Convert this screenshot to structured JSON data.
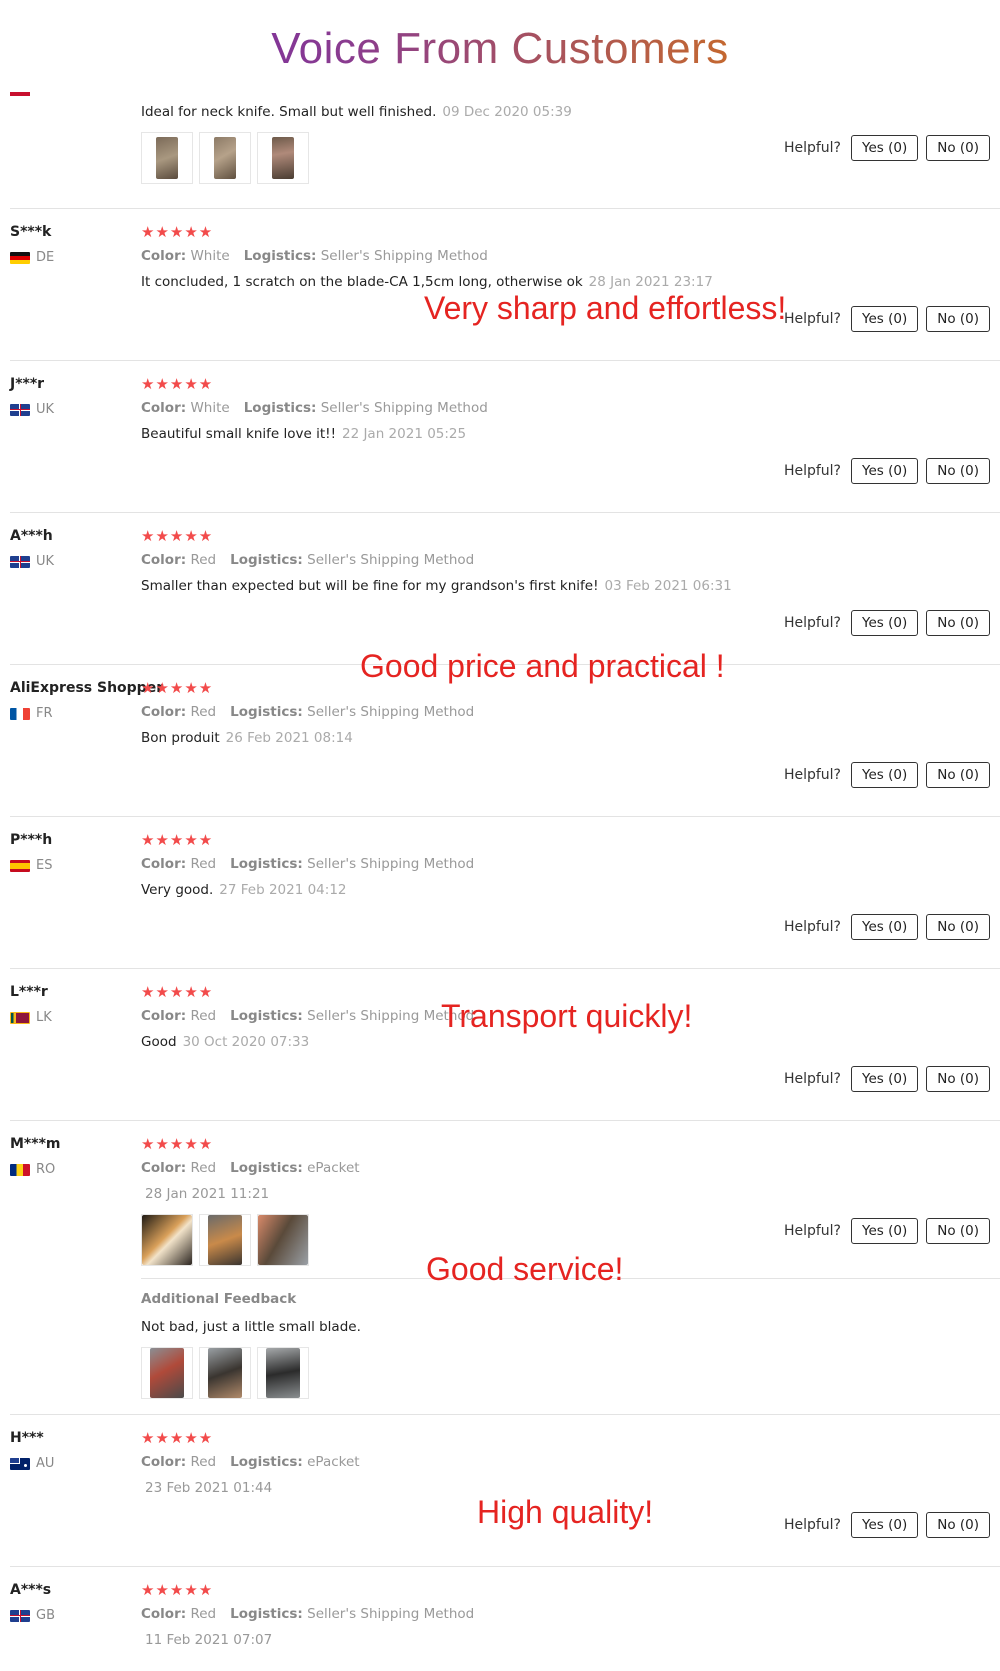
{
  "page_title": "Voice From Customers",
  "helpful_label": "Helpful?",
  "yes_label": "Yes (0)",
  "no_label": "No (0)",
  "color_label": "Color:",
  "logistics_label": "Logistics:",
  "stars": "★★★★★",
  "colors": {
    "star": "#f24b4b",
    "overlay": "#e52421"
  },
  "first_review": {
    "text": "Ideal for neck knife. Small but well finished.",
    "date": "09 Dec 2020 05:39",
    "thumbs": 3
  },
  "reviews": [
    {
      "user": "S***k",
      "country": "DE",
      "flag": "de",
      "color": "White",
      "logistics": "Seller's Shipping Method",
      "text": "It concluded, 1 scratch on the blade-CA 1,5cm long, otherwise ok",
      "date": "28 Jan 2021 23:17"
    },
    {
      "user": "J***r",
      "country": "UK",
      "flag": "uk",
      "color": "White",
      "logistics": "Seller's Shipping Method",
      "text": "Beautiful small knife love it!!",
      "date": "22 Jan 2021 05:25"
    },
    {
      "user": "A***h",
      "country": "UK",
      "flag": "uk",
      "color": "Red",
      "logistics": "Seller's Shipping Method",
      "text": "Smaller than expected but will be fine for my grandson's first knife!",
      "date": "03 Feb 2021 06:31"
    },
    {
      "user": "AliExpress Shopper",
      "country": "FR",
      "flag": "fr",
      "color": "Red",
      "logistics": "Seller's Shipping Method",
      "text": "Bon produit",
      "date": "26 Feb 2021 08:14"
    },
    {
      "user": "P***h",
      "country": "ES",
      "flag": "es",
      "color": "Red",
      "logistics": "Seller's Shipping Method",
      "text": "Very good.",
      "date": "27 Feb 2021 04:12"
    },
    {
      "user": "L***r",
      "country": "LK",
      "flag": "lk",
      "color": "Red",
      "logistics": "Seller's Shipping Method",
      "text": "Good",
      "date": "30 Oct 2020 07:33"
    },
    {
      "user": "M***m",
      "country": "RO",
      "flag": "ro",
      "color": "Red",
      "logistics": "ePacket",
      "date_only": "28 Jan 2021 11:21",
      "additional_label": "Additional Feedback",
      "additional_text": "Not bad, just a little small blade."
    },
    {
      "user": "H***",
      "country": "AU",
      "flag": "au",
      "color": "Red",
      "logistics": "ePacket",
      "date_only": "23 Feb 2021 01:44"
    },
    {
      "user": "A***s",
      "country": "GB",
      "flag": "uk",
      "color": "Red",
      "logistics": "Seller's Shipping Method",
      "date_only": "11 Feb 2021 07:07"
    }
  ],
  "overlays": [
    "Very sharp and effortless!",
    "Good price and practical !",
    "Transport quickly!",
    "Good service!",
    "High quality!"
  ]
}
